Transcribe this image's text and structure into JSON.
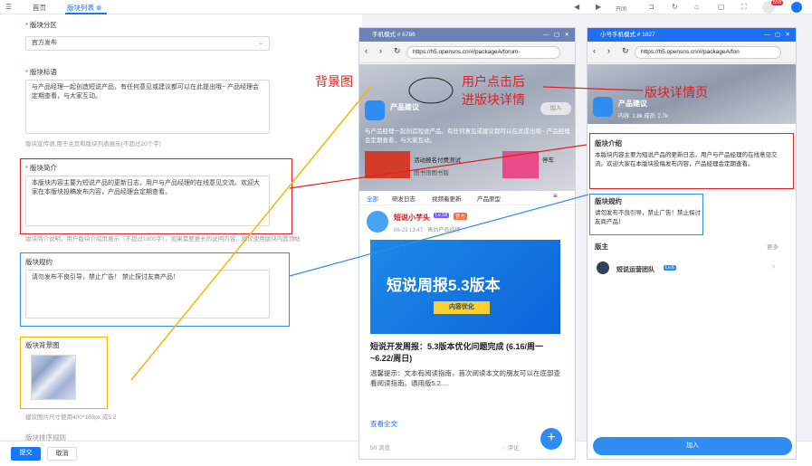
{
  "topbar": {
    "home": "首页",
    "active_tab": "版块列表",
    "tools": "开闭"
  },
  "form": {
    "section_label": "版块分区",
    "section_value": "官方发布",
    "name_label": "版块标语",
    "name_text": "与产品经理一起创造短说产品，有任何意见或建议都可以在此提出哦~ 产品经理会定期查看，与大家互动。",
    "name_hint": "版块宣传语,用于主页和版块列表展示(不超过20个字)",
    "intro_label": "版块简介",
    "intro_text": "本版块内容主要为短说产品的更新日志，用户与产品经理的在线意见交流。欢迎大家在本版块投稿发布内容，产品经理会定期查看。",
    "intro_hint": "版块简介说明，用户版块介绍页展示（不超过1000字），如果需要更长的说明内容，建议使用版块内置顶帖",
    "rules_label": "版块规约",
    "rules_text": "请勿发布不良引导，禁止广告！ 禁止探讨友商产品！",
    "bg_label": "版块背景图",
    "bg_hint": "建议图片尺寸使用400*160px,或5:2",
    "more_label": "版块排序规则"
  },
  "footer": {
    "submit": "提交",
    "cancel": "取消"
  },
  "phone1": {
    "title": "手机模式 # 6786",
    "url": "https://h5.opensns.cn/#/packageA/forum-",
    "forum_name": "产品建议",
    "join": "加入",
    "desc": "与产品经理一起创造短说产品，有任何意见或建议都可以在此提出哦~ 产品经理会定期查看，与大家互动。",
    "event1": "活动报名付费测试",
    "event2": "图书馆图书版",
    "event3": "停车",
    "tabs": [
      "全部",
      "研发日志",
      "视频着更新",
      "产品原型"
    ],
    "author": "短说小芋头",
    "level": "Lv.18",
    "badge": "官方",
    "post_time": "06-23 13:47 · 售后产品经理",
    "banner_title": "短说周报5.3版本",
    "banner_sub": "内容优化",
    "post_title": "短说开发周报：5.3版本优化问题完成 (6.16/周一~6.22/周日)",
    "post_body": "温馨提示：文本有阅读指南，首次阅读本文的朋友可以在底部查看阅读指南。通用版5.2....",
    "read_more": "查看全文",
    "views": "50 浏览",
    "comment": "评论"
  },
  "phone2": {
    "title": "小号手机模式 # 1827",
    "url": "https://h5.opensns.cn/#/packageA/fon",
    "forum_name": "产品建议",
    "stats": "内容: 1.8k  成员: 2.7k",
    "join": "加入",
    "intro_title": "版块介绍",
    "intro_text": "本版块内容主要为短说产品的更新日志，用户与产品经理的在线意见交流。欢迎大家在本版块投稿发布内容，产品经理会定期查看。",
    "rules_title": "版块规约",
    "rules_text": "请勿发布不良引导，禁止广告！禁止探讨友商产品！",
    "owner_title": "版主",
    "more": "更多",
    "owner_name": "短说运营团队",
    "owner_level": "Lv.6",
    "join_button": "加入"
  },
  "annotations": {
    "bg": "背景图",
    "click1": "用户点击后",
    "click2": "进版块详情",
    "detail": "版块详情页"
  },
  "badge_count": "558"
}
